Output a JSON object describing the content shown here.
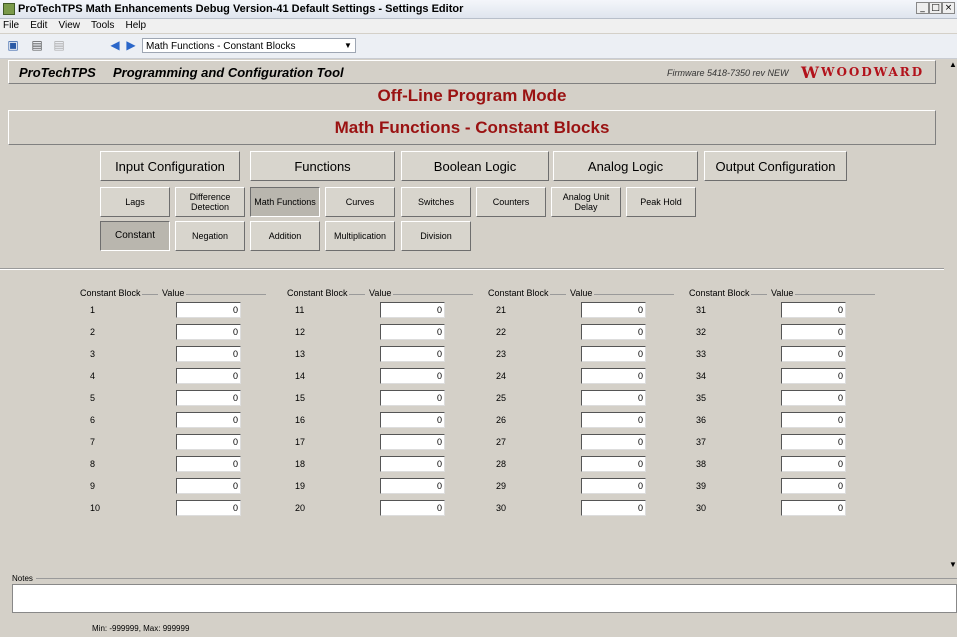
{
  "window": {
    "title": "ProTechTPS Math Enhancements Debug Version-41 Default Settings - Settings Editor",
    "controls": [
      "_",
      "□",
      "×"
    ]
  },
  "menu": [
    "File",
    "Edit",
    "View",
    "Tools",
    "Help"
  ],
  "toolbar": {
    "nav_value": "Math Functions - Constant Blocks",
    "icons": [
      "save-icon",
      "print-icon",
      "back-icon",
      "forward-icon"
    ]
  },
  "brand": {
    "product": "ProTechTPS",
    "tool": "Programming and Configuration Tool",
    "firmware": "Firmware 5418-7350 rev NEW",
    "logo_mark": "W",
    "logo_text": "WOODWARD",
    "accent": "#b2121b"
  },
  "mode_text": "Off-Line Program Mode",
  "panel_title": "Math Functions - Constant Blocks",
  "main_tabs": [
    "Input Configuration",
    "Functions",
    "Boolean Logic",
    "Analog Logic",
    "Output Configuration"
  ],
  "sub_tabs_row1": [
    "Lags",
    "Difference Detection",
    "Math Functions",
    "Curves",
    "Switches",
    "Counters",
    "Analog Unit Delay",
    "Peak Hold"
  ],
  "sub_tabs_row2": [
    "Constant",
    "Negation",
    "Addition",
    "Multiplication",
    "Division"
  ],
  "active": {
    "main_tab": "Functions",
    "sub_tab_row1": "Math Functions",
    "sub_tab_row2": "Constant"
  },
  "table": {
    "header_block": "Constant Block",
    "header_value": "Value",
    "columns": [
      {
        "blocks": [
          "1",
          "2",
          "3",
          "4",
          "5",
          "6",
          "7",
          "8",
          "9",
          "10"
        ],
        "values": [
          "0",
          "0",
          "0",
          "0",
          "0",
          "0",
          "0",
          "0",
          "0",
          "0"
        ]
      },
      {
        "blocks": [
          "11",
          "12",
          "13",
          "14",
          "15",
          "16",
          "17",
          "18",
          "19",
          "20"
        ],
        "values": [
          "0",
          "0",
          "0",
          "0",
          "0",
          "0",
          "0",
          "0",
          "0",
          "0"
        ]
      },
      {
        "blocks": [
          "21",
          "22",
          "23",
          "24",
          "25",
          "26",
          "27",
          "28",
          "29",
          "30"
        ],
        "values": [
          "0",
          "0",
          "0",
          "0",
          "0",
          "0",
          "0",
          "0",
          "0",
          "0"
        ]
      },
      {
        "blocks": [
          "31",
          "32",
          "33",
          "34",
          "35",
          "36",
          "37",
          "38",
          "39",
          "30"
        ],
        "values": [
          "0",
          "0",
          "0",
          "0",
          "0",
          "0",
          "0",
          "0",
          "0",
          "0"
        ]
      }
    ]
  },
  "notes_label": "Notes",
  "notes_value": "",
  "status": "Min: -999999, Max: 999999"
}
